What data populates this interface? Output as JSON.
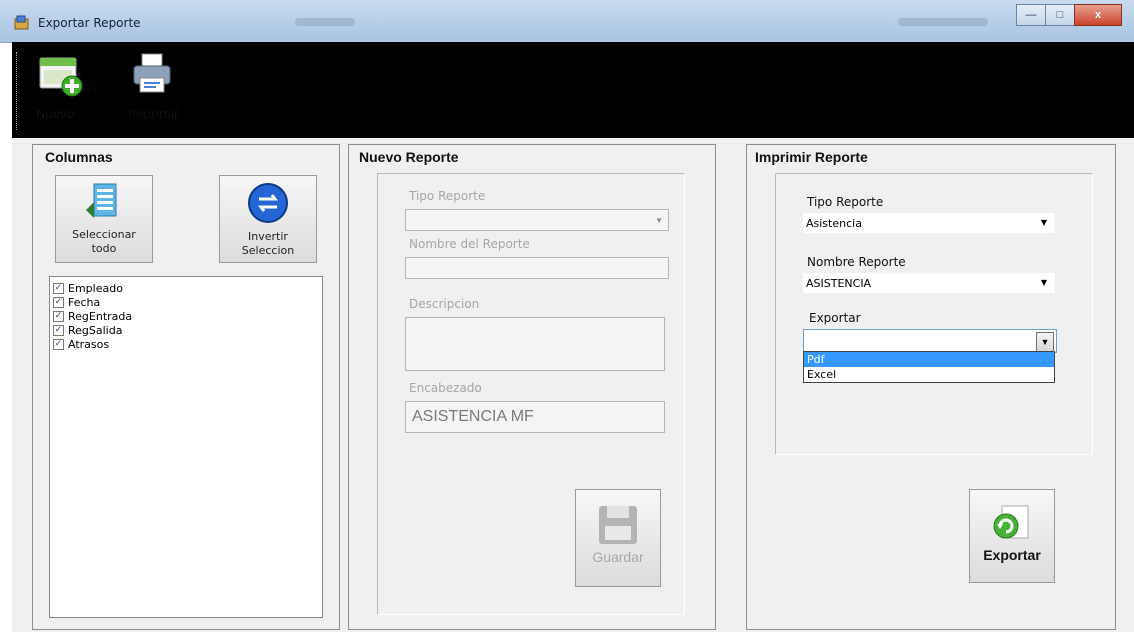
{
  "window": {
    "title": "Exportar Reporte",
    "controls": {
      "minimize": "—",
      "maximize": "□",
      "close": "x"
    }
  },
  "toolbar": {
    "nuevo_label": "Nuevo",
    "imprimir_label": "Imprimir"
  },
  "columnas": {
    "title": "Columnas",
    "select_all_label": "Seleccionar todo",
    "invert_label": "Invertir Seleccion",
    "items": [
      {
        "label": "Empleado",
        "checked": true
      },
      {
        "label": "Fecha",
        "checked": true
      },
      {
        "label": "RegEntrada",
        "checked": true
      },
      {
        "label": "RegSalida",
        "checked": true
      },
      {
        "label": "Atrasos",
        "checked": true
      }
    ],
    "check_mark": "✓"
  },
  "nuevo_reporte": {
    "title": "Nuevo Reporte",
    "tipo_label": "Tipo Reporte",
    "nombre_label": "Nombre del Reporte",
    "descripcion_label": "Descripcion",
    "encabezado_label": "Encabezado",
    "encabezado_value": "ASISTENCIA MF",
    "save_label": "Guardar"
  },
  "imprimir_reporte": {
    "title": "Imprimir Reporte",
    "tipo_label": "Tipo Reporte",
    "tipo_value": "Asistencia",
    "nombre_label": "Nombre Reporte",
    "nombre_value": "ASISTENCIA",
    "exportar_label": "Exportar",
    "exportar_value": "",
    "options": [
      "Pdf",
      "Excel"
    ],
    "selected_option": "Pdf",
    "export_button_label": "Exportar"
  },
  "colors": {
    "toolbar_bg": "#000000",
    "selection": "#3399ff",
    "panel_bg": "#f0f0f0"
  }
}
